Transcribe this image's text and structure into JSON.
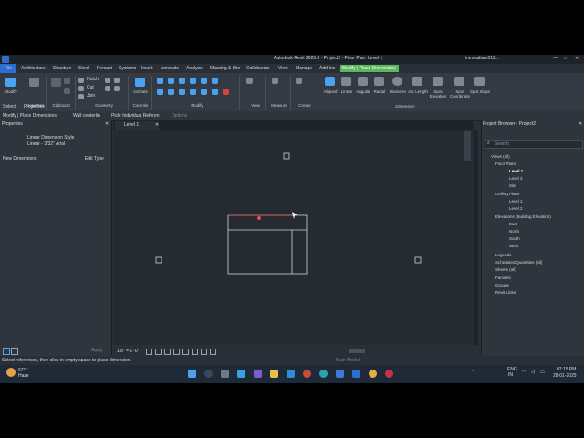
{
  "window": {
    "title": "Autodesk Revit 2025.3 - Project2 - Floor Plan: Level 1",
    "user": "imranaliam512..."
  },
  "ribbon_tabs": [
    "File",
    "Architecture",
    "Structure",
    "Steel",
    "Precast",
    "Systems",
    "Insert",
    "Annotate",
    "Analyze",
    "Massing & Site",
    "Collaborate",
    "View",
    "Manage",
    "Add-Ins",
    "Modify | Place Dimensions"
  ],
  "ribbon": {
    "modify": "Modify",
    "properties": "Properties",
    "clipboard": "Clipboard",
    "geometry": "Geometry",
    "notch": "Notch",
    "cut": "Cut",
    "join": "Join",
    "activate": "Activate",
    "controls": "Controls",
    "modify_group": "Modify",
    "view": "View",
    "measure": "Measure",
    "create": "Create",
    "dimension": "Dimension",
    "dim_buttons": [
      "Aligned",
      "Linear",
      "Angular",
      "Radial",
      "Diameter",
      "Arc Length",
      "Spot Elevation",
      "Spot Coordinate",
      "Spot Slope"
    ]
  },
  "options_bar": {
    "select": "Select",
    "properties": "Properties",
    "mode": "Modify | Place Dimensions",
    "wall": "Wall centerlin",
    "pick": "Pick: Individual Referen",
    "options": "Options"
  },
  "properties": {
    "title": "Properties",
    "type_line1": "Linear Dimension Style",
    "type_line2": "Linear - 3/32\" Arial",
    "new_item": "New Dimensions",
    "edit_type": "Edit Type",
    "apply": "Apply"
  },
  "view_tab": "Level 1",
  "view_controls": {
    "scale": "1/8\" = 1'-0\""
  },
  "project_browser": {
    "title": "Project Browser - Project2",
    "search": "Search",
    "tree": [
      "Views (all)",
      "Floor Plans",
      "Level 1",
      "Level 2",
      "Site",
      "Ceiling Plans",
      "Level 1",
      "Level 2",
      "Elevations (Building Elevation)",
      "East",
      "North",
      "South",
      "West",
      "Legends",
      "Schedules/Quantities (all)",
      "Sheets (all)",
      "Families",
      "Groups",
      "Revit Links"
    ]
  },
  "status": {
    "message": "Select references, then click in empty space to place dimension.",
    "model": "Main Model"
  },
  "taskbar": {
    "temp": "67°F",
    "condition": "Haze",
    "lang1": "ENG",
    "lang2": "IN",
    "time": "07:15 PM",
    "date": "28-01-2025"
  },
  "colors": {
    "accent": "#4aa3f0",
    "context_tab": "#5cb85c",
    "canvas": "#262b32"
  }
}
